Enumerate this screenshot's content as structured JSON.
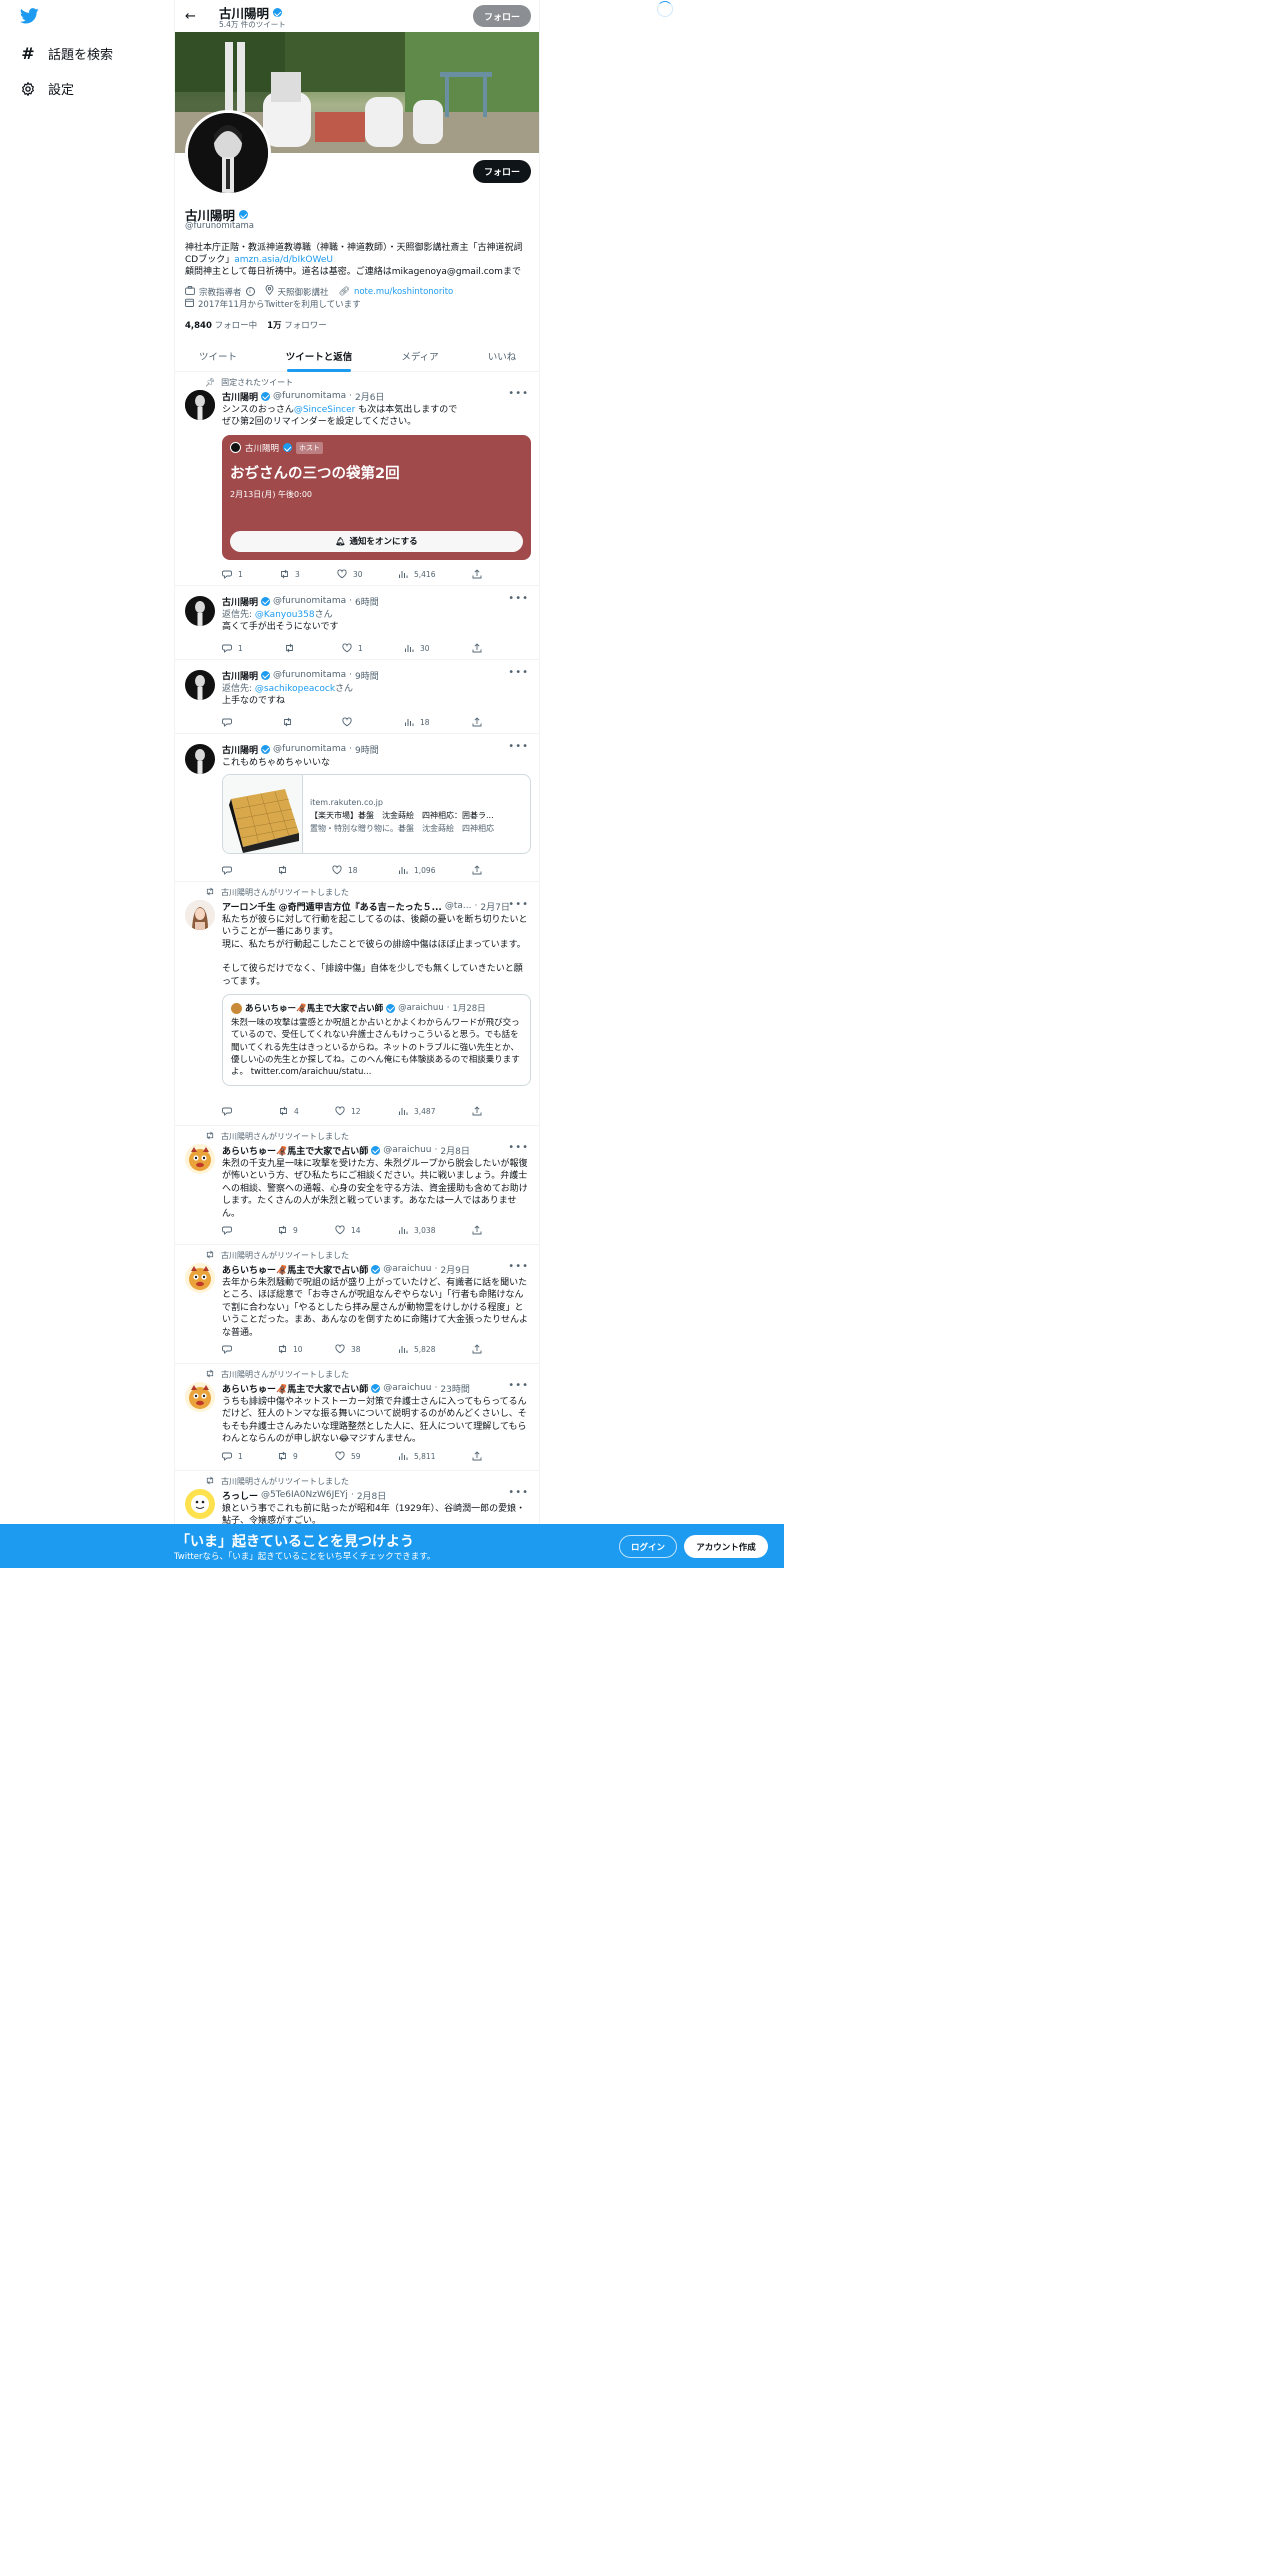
{
  "nav": {
    "explore": "話題を検索",
    "settings": "設定"
  },
  "header": {
    "name": "古川陽明",
    "tweet_count": "5.4万 件のツイート",
    "follow": "フォロー"
  },
  "profile": {
    "follow": "フォロー",
    "name": "古川陽明",
    "handle": "@furunomitama",
    "bio_line1": "神社本庁正階・教派神道教導職（神職・神道教師）・天照御影講社斎主「古神道祝詞CDブック」",
    "bio_link": "amzn.asia/d/bIkOWeU",
    "bio_line2": "顧問神主として毎日祈祷中。道名は基密。ご連絡はmikagenoya@gmail.comまで",
    "category": "宗教指導者",
    "location": "天照御影講社",
    "website": "note.mu/koshintonorito",
    "joined": "2017年11月からTwitterを利用しています",
    "following_count": "4,840",
    "following_label": "フォロー中",
    "followers_count": "1万",
    "followers_label": "フォロワー"
  },
  "tabs": [
    "ツイート",
    "ツイートと返信",
    "メディア",
    "いいね"
  ],
  "tweets": [
    {
      "pinned_label": "固定されたツイート",
      "name": "古川陽明",
      "handle": "@furunomitama",
      "time": "2月6日",
      "text_a": "シンスのおっさん",
      "mention": "@SinceSincer",
      "text_b": " も次は本気出しますので",
      "text_2": "ぜひ第2回のリマインダーを設定してください。",
      "card": {
        "host_name": "古川陽明",
        "host_badge": "ホスト",
        "title": "おぢさんの三つの袋第2回",
        "date": "2月13日(月) 午後0:00",
        "button": "通知をオンにする"
      },
      "replies": "1",
      "retweets": "3",
      "likes": "30",
      "views": "5,416"
    },
    {
      "name": "古川陽明",
      "handle": "@furunomitama",
      "time": "6時間",
      "reply_to_label": "返信先: ",
      "reply_to": "@Kanyou358",
      "reply_suffix": "さん",
      "text": "高くて手が出そうにないです",
      "replies": "1",
      "retweets": "",
      "likes": "1",
      "views": "30"
    },
    {
      "name": "古川陽明",
      "handle": "@furunomitama",
      "time": "9時間",
      "reply_to_label": "返信先: ",
      "reply_to": "@sachikopeacock",
      "reply_suffix": "さん",
      "text": "上手なのですね",
      "replies": "",
      "retweets": "",
      "likes": "",
      "views": "18"
    },
    {
      "name": "古川陽明",
      "handle": "@furunomitama",
      "time": "9時間",
      "text": "これもめちゃめちゃいいな",
      "link_card": {
        "domain": "item.rakuten.co.jp",
        "title": "【楽天市場】碁盤　沈金蒔絵　四神相応：囲碁ラ...",
        "desc": "置物・特別な贈り物に。碁盤　沈金蒔絵　四神相応"
      },
      "replies": "",
      "retweets": "",
      "likes": "18",
      "views": "1,096"
    },
    {
      "retweeted_by": "古川陽明さんがリツイートしました",
      "name": "アーロン千生 @奇門遁甲吉方位『ある吉－たった５...",
      "handle": "@ta...",
      "time": "2月7日",
      "text_lines": [
        "私たちが彼らに対して行動を起こしてるのは、後顧の憂いを断ち切りたいということが一番にあります。",
        "現に、私たちが行動起こしたことで彼らの誹謗中傷はほぼ止まっています。",
        "",
        "そして彼らだけでなく、「誹謗中傷」自体を少しでも無くしていきたいと願ってます。"
      ],
      "quote": {
        "name": "あらいちゅー🦧馬主で大家で占い師",
        "handle": "@araichuu",
        "time": "1月28日",
        "text": "朱烈一味の攻撃は霊感とか呪詛とか占いとかよくわからんワードが飛び交っているので、受任してくれない弁護士さんもけっこういると思う。でも話を聞いてくれる先生はきっといるからね。ネットのトラブルに強い先生とか、優しい心の先生とか探してね。このへん俺にも体験談あるので相談乗りますよ。 twitter.com/araichuu/statu..."
      },
      "replies": "",
      "retweets": "4",
      "likes": "12",
      "views": "3,487"
    },
    {
      "retweeted_by": "古川陽明さんがリツイートしました",
      "name": "あらいちゅー🦧馬主で大家で占い師",
      "handle": "@araichuu",
      "time": "2月8日",
      "text": "朱烈の千支九星一味に攻撃を受けた方、朱烈グループから脱会したいが報復が怖いという方、ぜひ私たちにご相談ください。共に戦いましょう。弁護士への相談、警察への通報、心身の安全を守る方法、資金援助も含めてお助けします。たくさんの人が朱烈と戦っています。あなたは一人ではありません。",
      "replies": "",
      "retweets": "9",
      "likes": "14",
      "views": "3,038"
    },
    {
      "retweeted_by": "古川陽明さんがリツイートしました",
      "name": "あらいちゅー🦧馬主で大家で占い師",
      "handle": "@araichuu",
      "time": "2月9日",
      "text": "去年から朱烈騒動で呪詛の話が盛り上がっていたけど、有識者に話を聞いたところ、ほぼ総意で「お寺さんが呪詛なんぞやらない」「行者も命賭けなんで割に合わない」「やるとしたら拝み屋さんが動物霊をけしかける程度」ということだった。まあ、あんなのを倒すために命賭けて大金張ったりせんよな普通。",
      "replies": "",
      "retweets": "10",
      "likes": "38",
      "views": "5,828"
    },
    {
      "retweeted_by": "古川陽明さんがリツイートしました",
      "name": "あらいちゅー🦧馬主で大家で占い師",
      "handle": "@araichuu",
      "time": "23時間",
      "text": "うちも誹謗中傷やネットストーカー対策で弁護士さんに入ってもらってるんだけど、狂人のトンマな振る舞いについて説明するのがめんどくさいし、そもそも弁護士さんみたいな理路整然とした人に、狂人について理解してもらわんとならんのが申し訳ない😂マジすんません。",
      "replies": "1",
      "retweets": "9",
      "likes": "59",
      "views": "5,811"
    },
    {
      "retweeted_by": "古川陽明さんがリツイートしました",
      "name": "ろっしー",
      "handle": "@5Te6IA0NzW6JEYj",
      "time": "2月8日",
      "text": "娘という事でこれも前に貼ったが昭和4年（1929年）、谷崎潤一郎の愛娘・鮎子、令嬢感がすごい。"
    }
  ],
  "bottom_bar": {
    "title": "「いま」起きていることを見つけよう",
    "subtitle": "Twitterなら、「いま」起きていることをいち早くチェックできます。",
    "login": "ログイン",
    "signup": "アカウント作成"
  },
  "colors": {
    "accent": "#1d9bf0",
    "spaces_card": "#a04a4c",
    "text": "#0f1419",
    "muted": "#536471"
  }
}
